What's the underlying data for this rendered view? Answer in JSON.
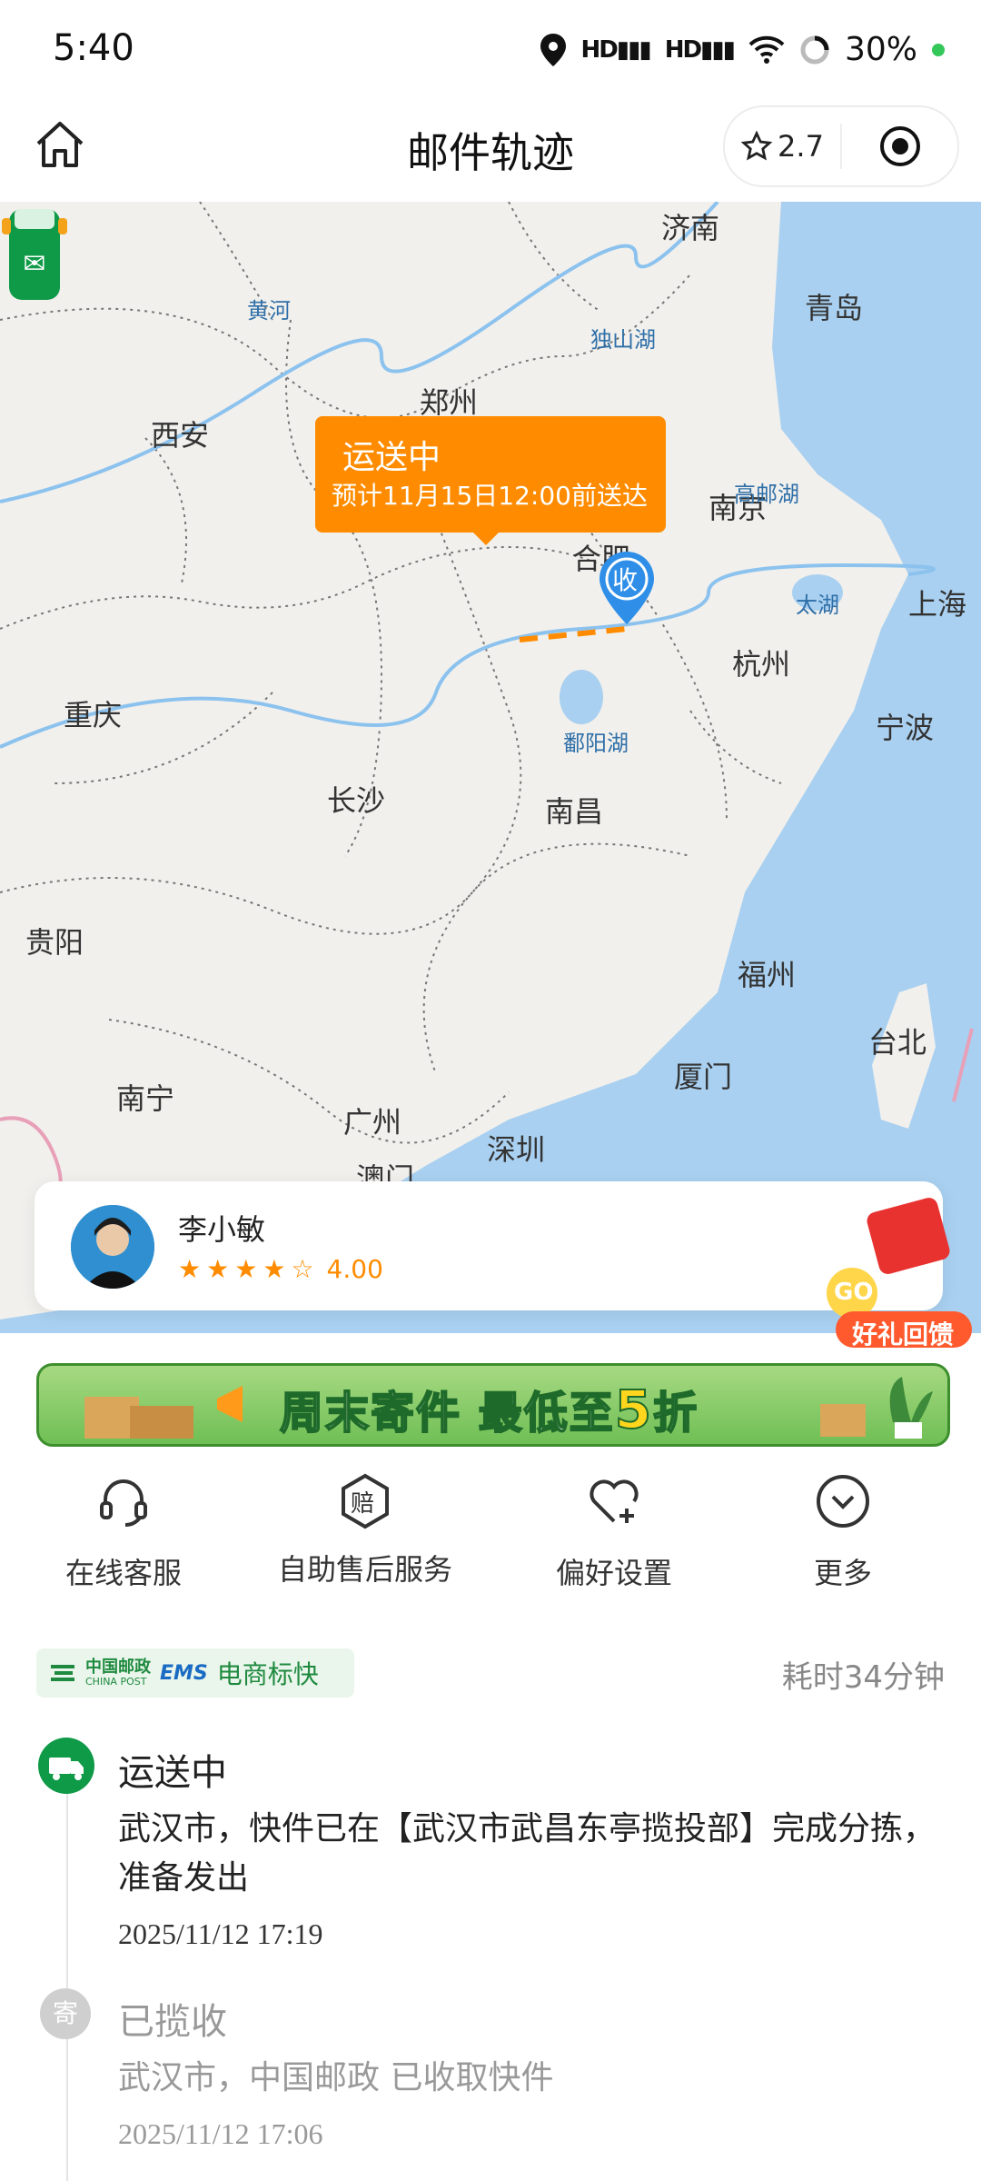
{
  "status_bar": {
    "time": "5:40",
    "battery": "30%"
  },
  "header": {
    "title": "邮件轨迹",
    "rating": "2.7"
  },
  "map": {
    "cities": [
      {
        "name": "济南"
      },
      {
        "name": "青岛"
      },
      {
        "name": "郑州"
      },
      {
        "name": "西安"
      },
      {
        "name": "南京"
      },
      {
        "name": "合肥"
      },
      {
        "name": "上海"
      },
      {
        "name": "杭州"
      },
      {
        "name": "宁波"
      },
      {
        "name": "重庆"
      },
      {
        "name": "长沙"
      },
      {
        "name": "南昌"
      },
      {
        "name": "贵阳"
      },
      {
        "name": "福州"
      },
      {
        "name": "台北"
      },
      {
        "name": "厦门"
      },
      {
        "name": "南宁"
      },
      {
        "name": "广州"
      },
      {
        "name": "深圳"
      },
      {
        "name": "澳门"
      }
    ],
    "water": [
      {
        "name": "黄河"
      },
      {
        "name": "独山湖"
      },
      {
        "name": "高邮湖"
      },
      {
        "name": "太湖"
      },
      {
        "name": "鄱阳湖"
      }
    ],
    "callout": {
      "status": "运送中",
      "eta": "预计11月15日12:00前送达"
    },
    "receiver_pin": "收"
  },
  "courier": {
    "name": "李小敏",
    "rating": "4.00",
    "stars_filled": 4,
    "stars_total": 5
  },
  "gift": {
    "go": "GO",
    "label": "好礼回馈"
  },
  "promo": {
    "text_a": "周末寄件 最低至",
    "text_big": "5",
    "text_b": "折"
  },
  "actions": [
    {
      "label": "在线客服",
      "icon": "headset-icon"
    },
    {
      "label": "自助售后服务",
      "icon": "compensation-icon"
    },
    {
      "label": "偏好设置",
      "icon": "heart-plus-icon"
    },
    {
      "label": "更多",
      "icon": "chevron-down-circle-icon"
    }
  ],
  "tracking": {
    "brand": {
      "china_post": "中国邮政",
      "china_post_en": "CHINA POST",
      "ems": "EMS",
      "service": "电商标快"
    },
    "elapsed": "耗时34分钟",
    "events": [
      {
        "status": "运送中",
        "desc": "武汉市，快件已在【武汉市武昌东亭揽投部】完成分拣，准备发出",
        "time": "2025/11/12 17:19"
      },
      {
        "status": "已揽收",
        "icon_text": "寄",
        "desc": "武汉市，中国邮政 已收取快件",
        "time": "2025/11/12 17:06"
      }
    ]
  },
  "colors": {
    "accent": "#ff8c00",
    "brand_green": "#0f9a48",
    "sea": "#a9d0f0"
  }
}
